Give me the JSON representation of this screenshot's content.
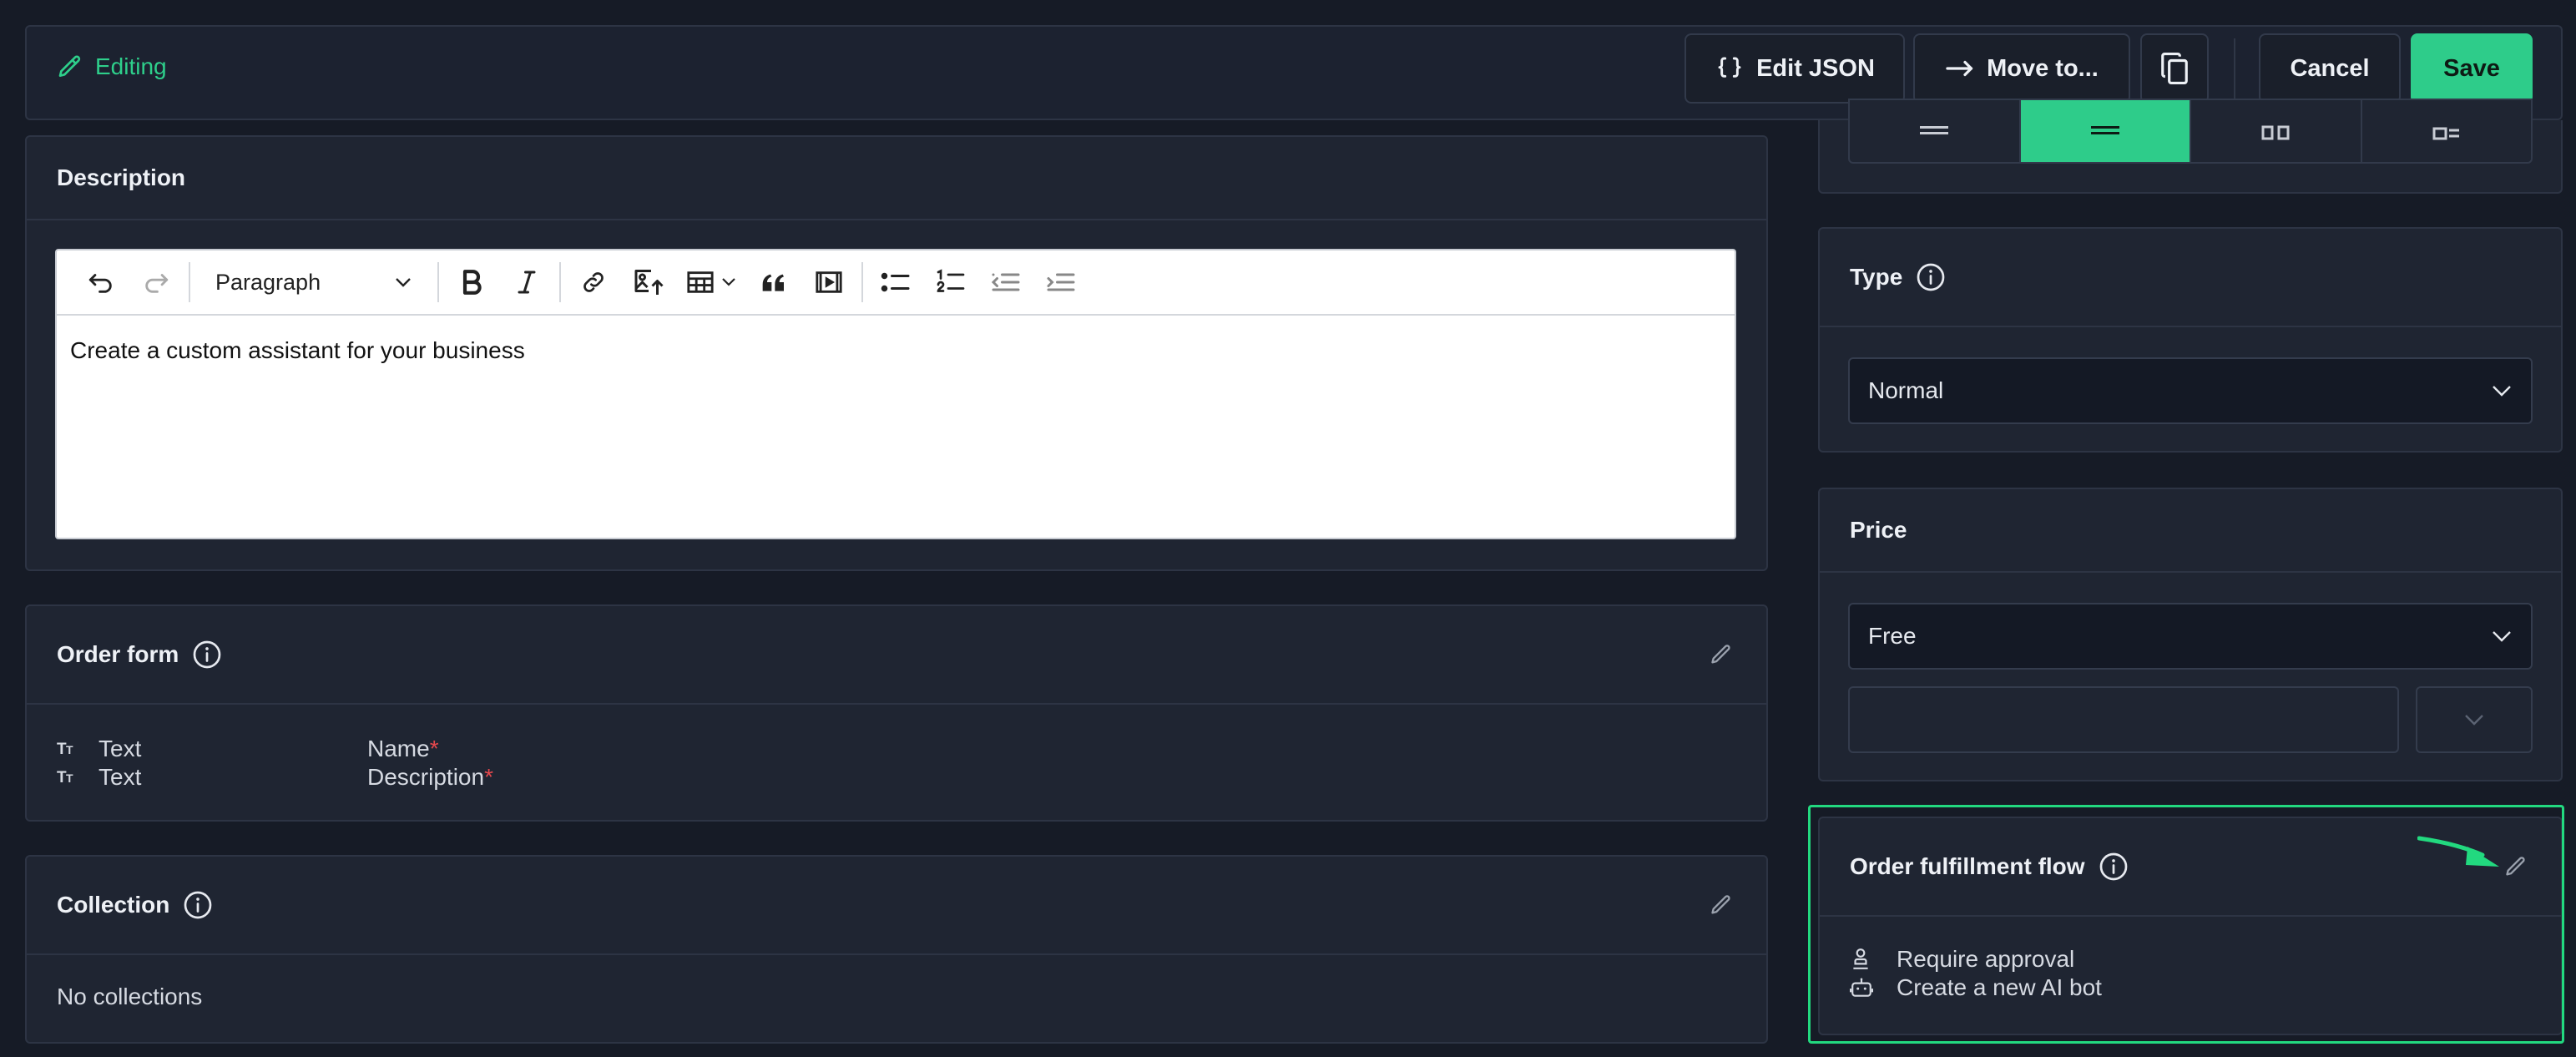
{
  "topbar": {
    "editing_label": "Editing",
    "edit_json_label": "Edit JSON",
    "move_to_label": "Move to...",
    "cancel_label": "Cancel",
    "save_label": "Save"
  },
  "description": {
    "title": "Description",
    "paragraph_style": "Paragraph",
    "content": "Create a custom assistant for your business"
  },
  "order_form": {
    "title": "Order form",
    "fields": [
      {
        "type": "Text",
        "name": "Name",
        "required_mark": "*"
      },
      {
        "type": "Text",
        "name": "Description",
        "required_mark": "*"
      }
    ]
  },
  "collection": {
    "title": "Collection",
    "empty_text": "No collections"
  },
  "type": {
    "title": "Type",
    "value": "Normal"
  },
  "price": {
    "title": "Price",
    "value": "Free"
  },
  "fulfillment": {
    "title": "Order fulfillment flow",
    "steps": [
      {
        "icon": "person-stamp-icon",
        "label": "Require approval"
      },
      {
        "icon": "robot-icon",
        "label": "Create a new AI bot"
      }
    ]
  },
  "colors": {
    "accent": "#2ecc8a",
    "highlight": "#22d97f",
    "background": "#161b26",
    "panel": "#1f2532",
    "required": "#e5484d"
  }
}
